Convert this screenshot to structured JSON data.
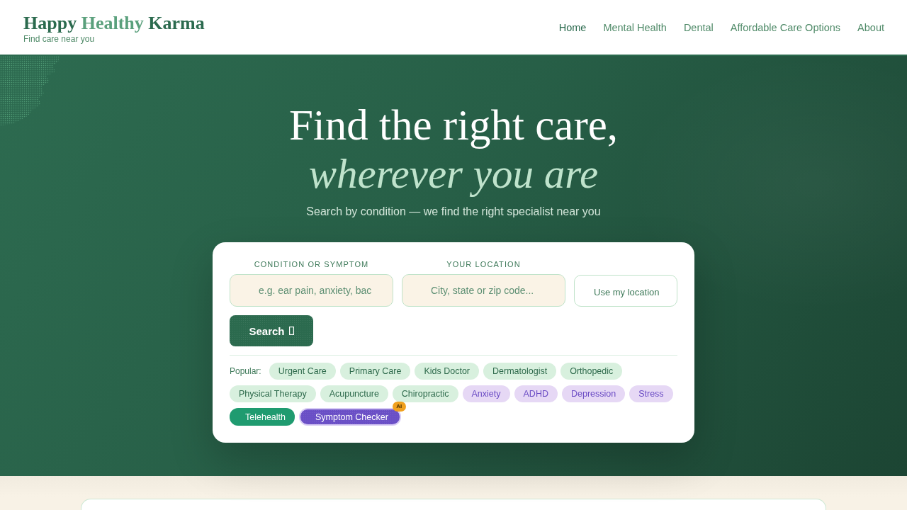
{
  "header": {
    "logo": [
      {
        "text": "Happy",
        "accent": false
      },
      {
        "text": "Healthy",
        "accent": true
      },
      {
        "text": "Karma",
        "accent": false
      }
    ],
    "tagline": "Find care near you",
    "nav": [
      {
        "label": "Home",
        "selected": true
      },
      {
        "label": "Mental Health",
        "selected": false
      },
      {
        "label": "Dental",
        "selected": false
      },
      {
        "label": "Affordable Care Options",
        "selected": false
      },
      {
        "label": "About",
        "selected": false
      }
    ]
  },
  "hero": {
    "title": "Find the right care,",
    "title_emphasis": "wherever you are",
    "subtitle": "Search by condition — we find the right specialist near you"
  },
  "search_card": {
    "fields": [
      {
        "label": "CONDITION OR SYMPTOM",
        "placeholder": "e.g. ear pain, anxiety, bac"
      },
      {
        "label": "YOUR LOCATION",
        "placeholder": "City, state or zip code..."
      }
    ],
    "location_button": "Use my location",
    "search_button": "Search",
    "popular": {
      "label": "Popular:",
      "chips": [
        {
          "label": "Urgent Care",
          "kind": "specialty"
        },
        {
          "label": "Primary Care",
          "kind": "specialty"
        },
        {
          "label": "Kids Doctor",
          "kind": "specialty"
        },
        {
          "label": "Dermatologist",
          "kind": "specialty"
        },
        {
          "label": "Orthopedic",
          "kind": "specialty"
        },
        {
          "label": "Physical Therapy",
          "kind": "specialty"
        },
        {
          "label": "Acupuncture",
          "kind": "specialty"
        },
        {
          "label": "Chiropractic",
          "kind": "specialty"
        },
        {
          "label": "Anxiety",
          "kind": "mental"
        },
        {
          "label": "ADHD",
          "kind": "mental"
        },
        {
          "label": "Depression",
          "kind": "mental"
        },
        {
          "label": "Stress",
          "kind": "mental"
        },
        {
          "label": "Telehealth",
          "kind": "telehealth"
        },
        {
          "label": "Symptom Checker",
          "kind": "ai",
          "badge": "AI"
        }
      ]
    }
  }
}
